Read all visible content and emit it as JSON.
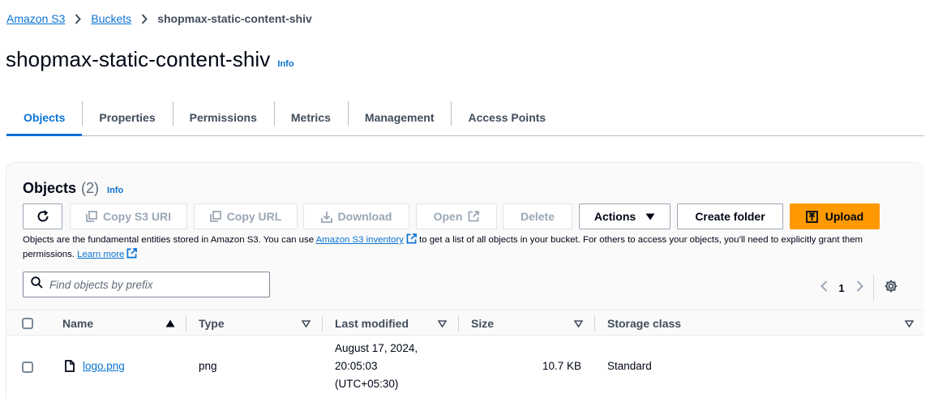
{
  "breadcrumb": {
    "items": [
      "Amazon S3",
      "Buckets"
    ],
    "current": "shopmax-static-content-shiv"
  },
  "header": {
    "title": "shopmax-static-content-shiv",
    "info": "Info"
  },
  "tabs": [
    {
      "label": "Objects",
      "active": true
    },
    {
      "label": "Properties"
    },
    {
      "label": "Permissions"
    },
    {
      "label": "Metrics"
    },
    {
      "label": "Management"
    },
    {
      "label": "Access Points"
    }
  ],
  "objects_panel": {
    "title": "Objects",
    "count": "(2)",
    "info": "Info",
    "toolbar": {
      "copy_s3_uri": "Copy S3 URI",
      "copy_url": "Copy URL",
      "download": "Download",
      "open": "Open",
      "delete": "Delete",
      "actions": "Actions",
      "create_folder": "Create folder",
      "upload": "Upload"
    },
    "description": {
      "part1": "Objects are the fundamental entities stored in Amazon S3. You can use ",
      "link1": "Amazon S3 inventory",
      "part2": " to get a list of all objects in your bucket. For others to access your objects, you’ll need to explicitly grant them permissions. ",
      "link2": "Learn more"
    },
    "search": {
      "placeholder": "Find objects by prefix",
      "value": ""
    },
    "pagination": {
      "current_page": "1"
    },
    "table": {
      "columns": [
        "Name",
        "Type",
        "Last modified",
        "Size",
        "Storage class"
      ],
      "rows": [
        {
          "name": "logo.png",
          "type": "png",
          "last_modified_1": "August 17, 2024,",
          "last_modified_2": "20:05:03",
          "last_modified_3": "(UTC+05:30)",
          "size": "10.7 KB",
          "storage_class": "Standard"
        }
      ]
    }
  },
  "colors": {
    "link": "#0972d3",
    "primary_button": "#ff9900",
    "text": "#000716",
    "muted": "#414d5c",
    "disabled": "#9ba7b6"
  }
}
